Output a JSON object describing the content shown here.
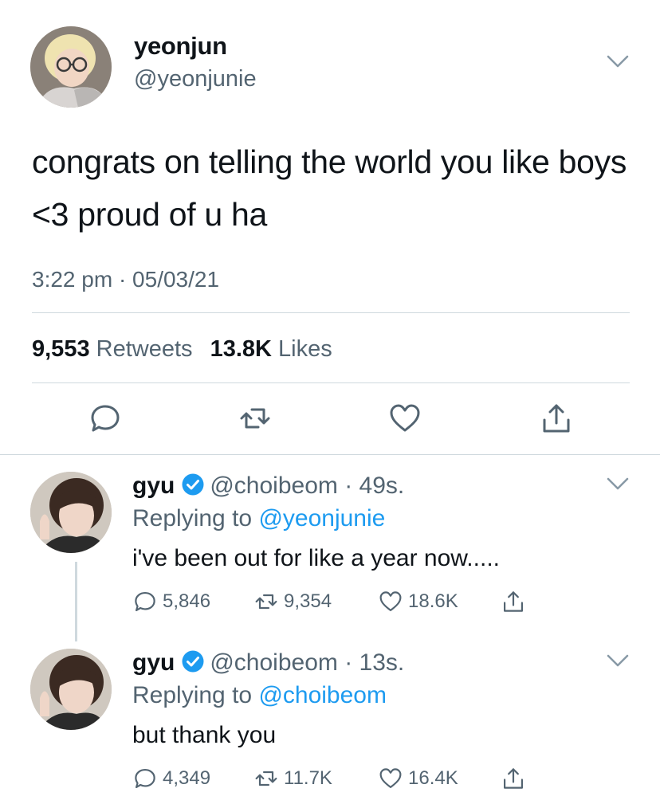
{
  "main_tweet": {
    "display_name": "yeonjun",
    "handle": "@yeonjunie",
    "text": "congrats on telling the world you like boys <3 proud of u ha",
    "time": "3:22 pm · 05/03/21",
    "retweets_count": "9,553",
    "retweets_label": "Retweets",
    "likes_count": "13.8K",
    "likes_label": "Likes"
  },
  "replies": [
    {
      "display_name": "gyu",
      "handle": "@choibeom",
      "age": "· 49s.",
      "replying_prefix": "Replying to",
      "replying_to": "@yeonjunie",
      "text": "i've been out for like a year now.....",
      "reply_count": "5,846",
      "retweet_count": "9,354",
      "like_count": "18.6K"
    },
    {
      "display_name": "gyu",
      "handle": "@choibeom",
      "age": "· 13s.",
      "replying_prefix": "Replying to",
      "replying_to": "@choibeom",
      "text": "but thank you",
      "reply_count": "4,349",
      "retweet_count": "11.7K",
      "like_count": "16.4K"
    }
  ],
  "colors": {
    "text": "#0f1419",
    "secondary": "#536471",
    "accent": "#1d9bf0",
    "divider": "#cfd9de"
  },
  "icons": [
    "chevron-down-icon",
    "reply-icon",
    "retweet-icon",
    "like-icon",
    "share-icon",
    "verified-badge-icon"
  ]
}
